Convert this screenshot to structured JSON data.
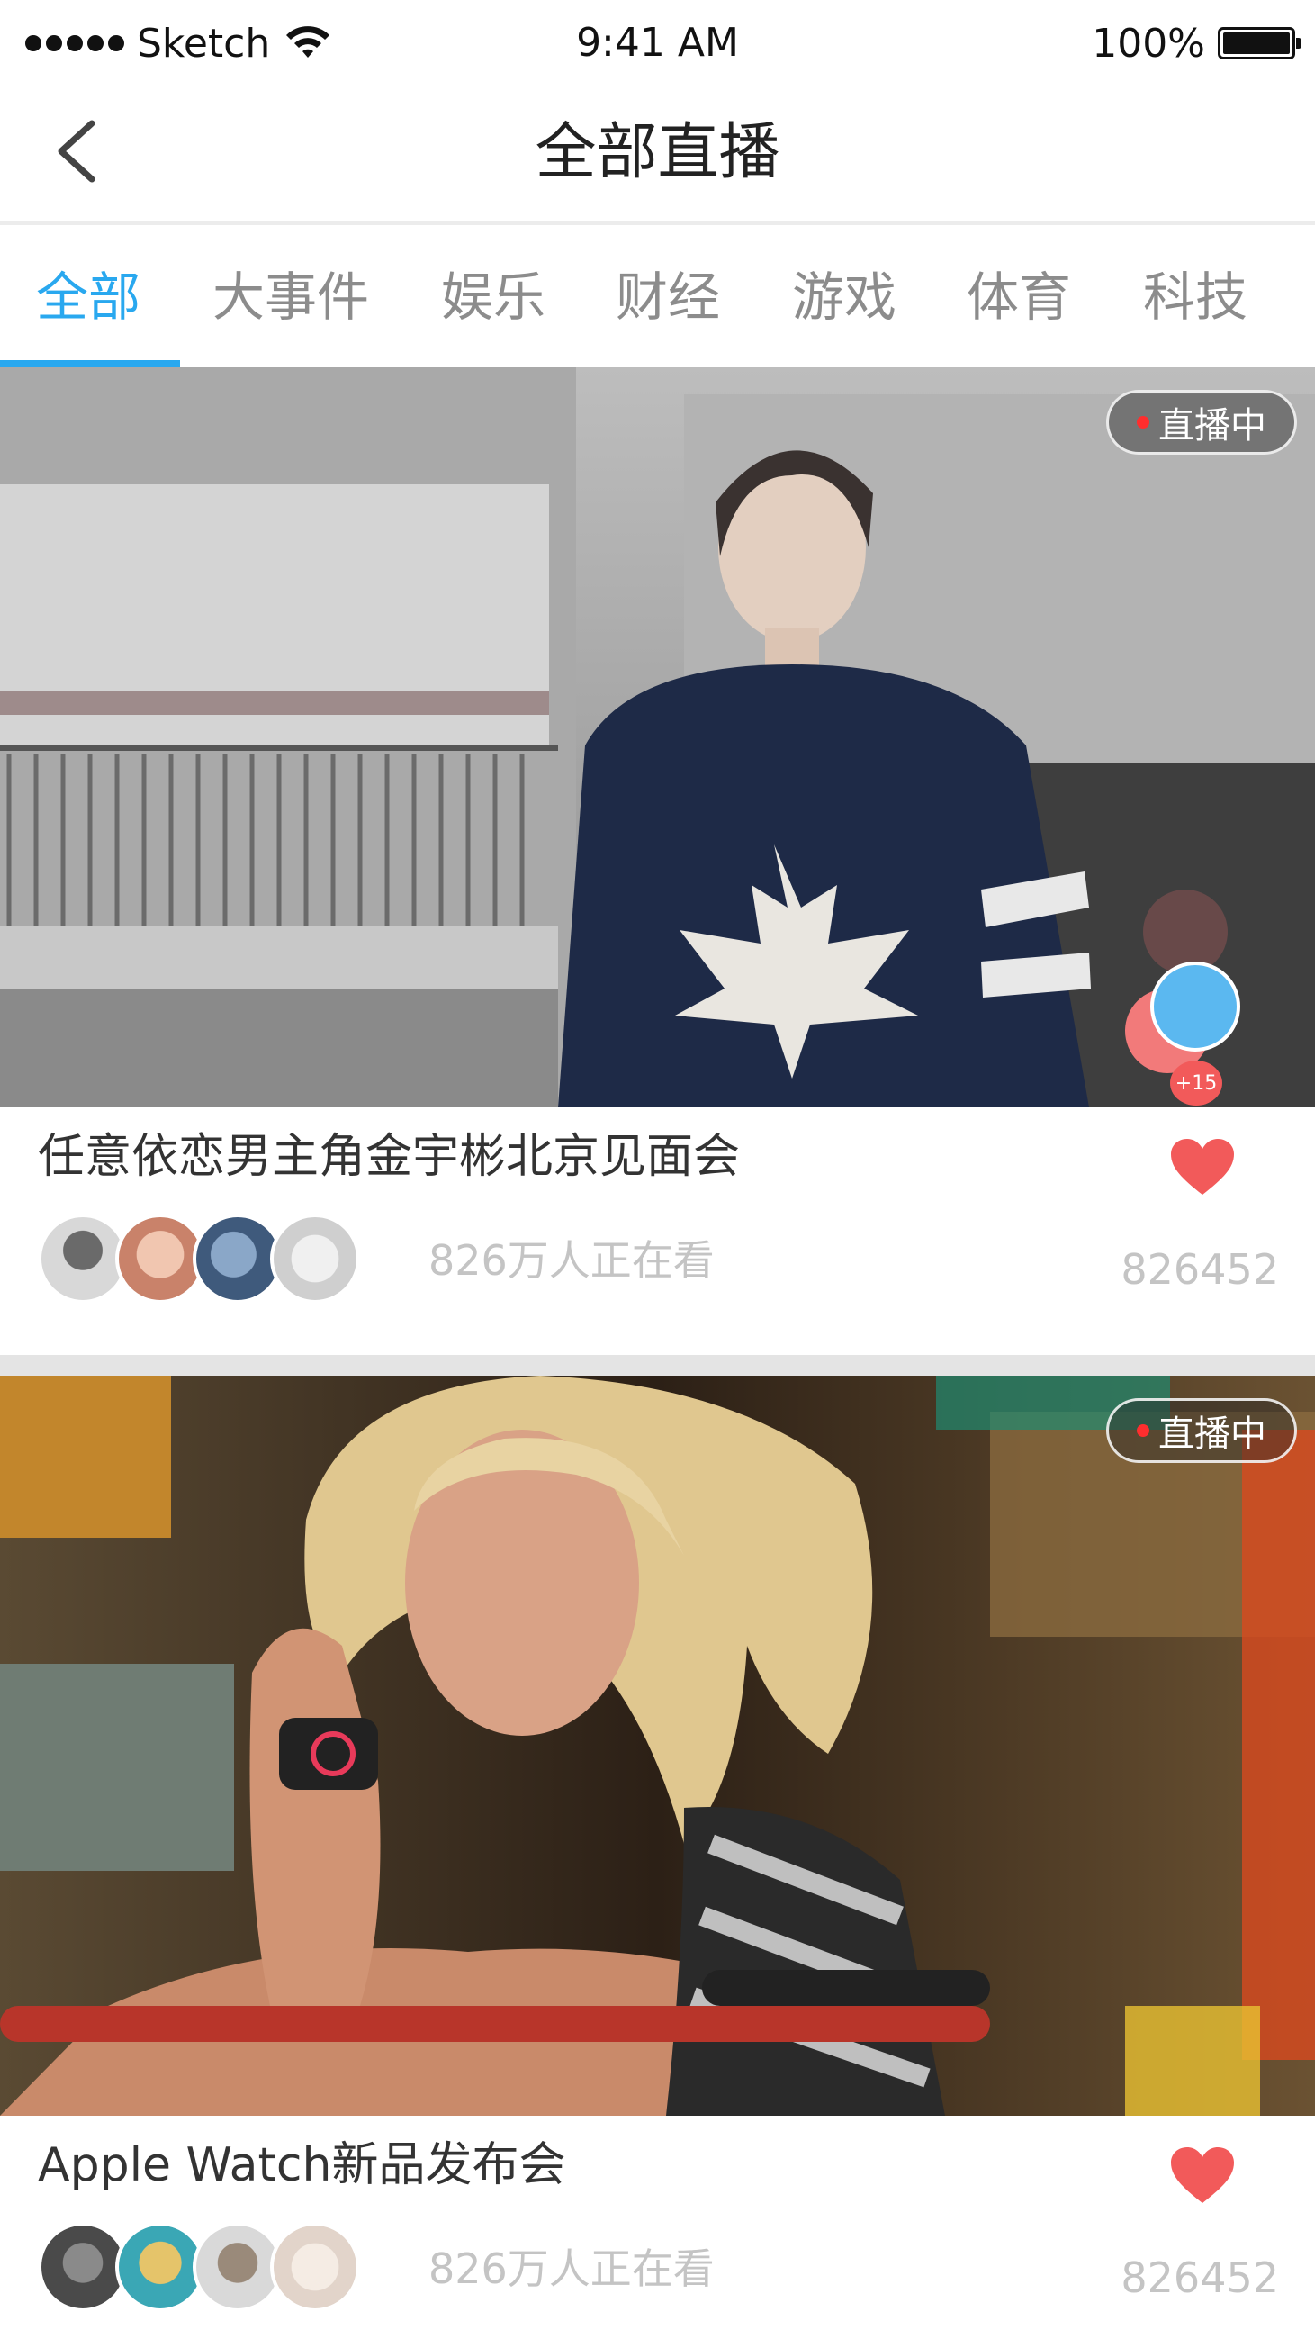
{
  "status_bar": {
    "carrier": "Sketch",
    "time": "9:41 AM",
    "battery": "100%"
  },
  "nav": {
    "title": "全部直播",
    "back_icon": "chevron-left-icon"
  },
  "tabs": [
    {
      "label": "全部",
      "active": true
    },
    {
      "label": "大事件",
      "active": false
    },
    {
      "label": "娱乐",
      "active": false
    },
    {
      "label": "财经",
      "active": false
    },
    {
      "label": "游戏",
      "active": false
    },
    {
      "label": "体育",
      "active": false
    },
    {
      "label": "科技",
      "active": false
    }
  ],
  "colors": {
    "accent": "#29a8ef",
    "like": "#f25a5a",
    "live_dot": "#ff2e2e"
  },
  "feed": [
    {
      "live_label": "直播中",
      "title": "任意依恋男主角金宇彬北京见面会",
      "watching": "826万人正在看",
      "likes": "826452",
      "reaction_badge": "+15"
    },
    {
      "live_label": "直播中",
      "title": "Apple Watch新品发布会",
      "watching": "826万人正在看",
      "likes": "826452"
    }
  ]
}
